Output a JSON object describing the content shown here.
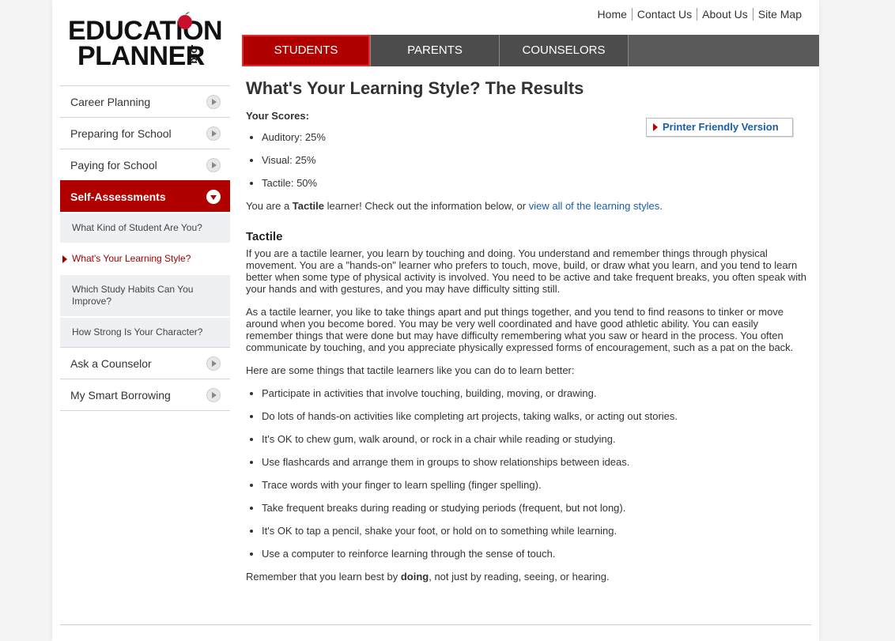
{
  "brand": {
    "line1": "EDUCATION",
    "line2": "PLANNER",
    "suffix": ".org",
    "apple_color": "#c8102e"
  },
  "toplinks": [
    "Home",
    "Contact Us",
    "About Us",
    "Site Map"
  ],
  "tabs": [
    {
      "label": "STUDENTS",
      "active": true
    },
    {
      "label": "PARENTS",
      "active": false
    },
    {
      "label": "COUNSELORS",
      "active": false
    }
  ],
  "sidebar": {
    "items_top": [
      "Career Planning",
      "Preparing for School",
      "Paying for School"
    ],
    "active": "Self-Assessments",
    "sub_items": [
      "What Kind of Student Are You?",
      "What's Your Learning Style?",
      "Which Study Habits Can You Improve?",
      "How Strong Is Your Character?"
    ],
    "current_sub": 1,
    "items_bottom": [
      "Ask a Counselor",
      "My Smart Borrowing"
    ]
  },
  "main": {
    "title": "What's Your Learning Style? The Results",
    "scores_label": "Your Scores:",
    "printer_label": "Printer Friendly Version",
    "scores": [
      "Auditory: 25%",
      "Visual: 25%",
      "Tactile: 50%"
    ],
    "result_pre": "You are a ",
    "result_bold": "Tactile",
    "result_mid": " learner! Check out the information below, or ",
    "result_link": "view all of the learning styles",
    "result_end": ".",
    "section_title": "Tactile",
    "para1": "If you are a tactile learner, you learn by touching and doing. You understand and remember things through physical movement. You are a \"hands-on\" learner who prefers to touch, move, build, or draw what you learn, and you tend to learn better when some type of physical activity is involved. You need to be active and take frequent breaks, you often speak with your hands and with gestures, and you may have difficulty sitting still.",
    "para2": "As a tactile learner, you like to take things apart and put things together, and you tend to find reasons to tinker or move around when you become bored. You may be very well coordinated and have good athletic ability. You can easily remember things that were done but may have difficulty remembering what you saw or heard in the process. You often communicate by touching, and you appreciate physically expressed forms of encouragement, such as a pat on the back.",
    "tips_intro": "Here are some things that tactile learners like you can do to learn better:",
    "tips": [
      "Participate in activities that involve touching, building, moving, or drawing.",
      "Do lots of hands-on activities like completing art projects, taking walks, or acting out stories.",
      "It's OK to chew gum, walk around, or rock in a chair while reading or studying.",
      "Use flashcards and arrange them in groups to show relationships between ideas.",
      "Trace words with your finger to learn spelling (finger spelling).",
      "Take frequent breaks during reading or studying periods (frequent, but not long).",
      "It's OK to tap a pencil, shake your foot, or hold on to something while learning.",
      "Use a computer to reinforce learning through the sense of touch."
    ],
    "closing_pre": "Remember that you learn best by ",
    "closing_bold": "doing",
    "closing_end": ", not just by reading, seeing, or hearing."
  }
}
